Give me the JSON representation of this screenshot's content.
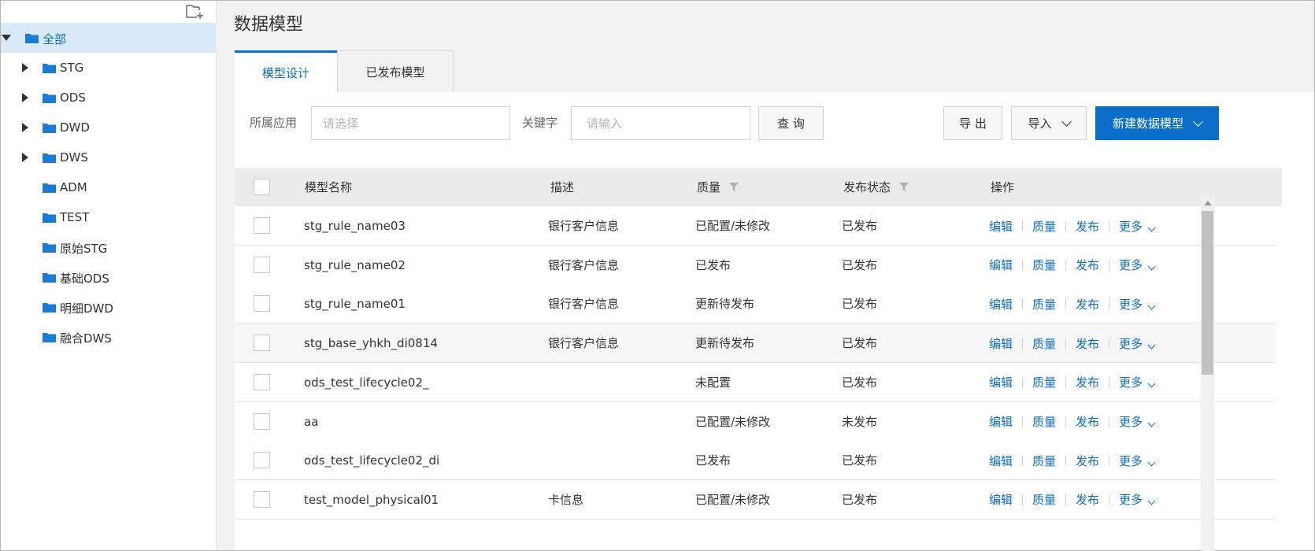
{
  "sidebar": {
    "add_icon": "folder-add-icon",
    "items": [
      {
        "label": "全部",
        "expanded": true,
        "selected": true
      },
      {
        "label": "STG",
        "expandable": true
      },
      {
        "label": "ODS",
        "expandable": true
      },
      {
        "label": "DWD",
        "expandable": true
      },
      {
        "label": "DWS",
        "expandable": true
      },
      {
        "label": "ADM",
        "expandable": false
      },
      {
        "label": "TEST",
        "expandable": false
      },
      {
        "label": "原始STG",
        "expandable": false
      },
      {
        "label": "基础ODS",
        "expandable": false
      },
      {
        "label": "明细DWD",
        "expandable": false
      },
      {
        "label": "融合DWS",
        "expandable": false
      }
    ]
  },
  "header": {
    "title": "数据模型"
  },
  "tabs": [
    {
      "label": "模型设计",
      "active": true
    },
    {
      "label": "已发布模型",
      "active": false
    }
  ],
  "filters": {
    "app_label": "所属应用",
    "app_placeholder": "请选择",
    "keyword_label": "关键字",
    "keyword_placeholder": "请输入",
    "query_button": "查 询"
  },
  "toolbar": {
    "export_label": "导 出",
    "import_label": "导入",
    "new_label": "新建数据模型"
  },
  "table": {
    "columns": [
      "模型名称",
      "描述",
      "质量",
      "发布状态",
      "操作"
    ],
    "rows": [
      {
        "name": "stg_rule_name03",
        "desc": "银行客户信息",
        "quality": "已配置/未修改",
        "status": "已发布"
      },
      {
        "name": "stg_rule_name02",
        "desc": "银行客户信息",
        "quality": "已发布",
        "status": "已发布"
      },
      {
        "name": "stg_rule_name01",
        "desc": "银行客户信息",
        "quality": "更新待发布",
        "status": "已发布"
      },
      {
        "name": "stg_base_yhkh_di0814",
        "desc": "银行客户信息",
        "quality": "更新待发布",
        "status": "已发布"
      },
      {
        "name": "ods_test_lifecycle02_",
        "desc": "",
        "quality": "未配置",
        "status": "已发布"
      },
      {
        "name": "aa",
        "desc": "",
        "quality": "已配置/未修改",
        "status": "未发布"
      },
      {
        "name": "ods_test_lifecycle02_di",
        "desc": "",
        "quality": "已发布",
        "status": "已发布"
      },
      {
        "name": "test_model_physical01",
        "desc": "卡信息",
        "quality": "已配置/未修改",
        "status": "已发布"
      }
    ],
    "actions": {
      "edit": "编辑",
      "quality": "质量",
      "publish": "发布",
      "more": "更多"
    }
  },
  "colors": {
    "accent": "#0b6fca",
    "selected_bg": "#d9e9f8",
    "page_bg": "#f2f2f2",
    "header_bg": "#ebebeb"
  }
}
